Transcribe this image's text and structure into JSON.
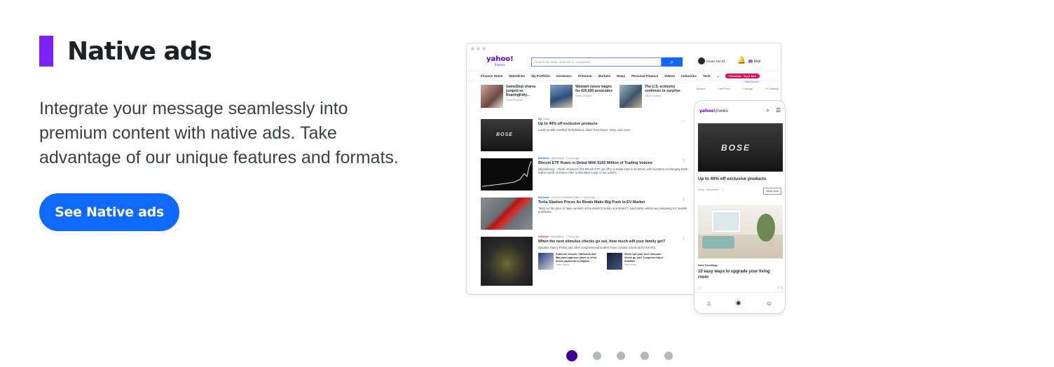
{
  "section": {
    "title": "Native ads",
    "description": "Integrate your message seamlessly into premium content with native ads. Take advantage of our unique features and formats.",
    "cta_label": "See Native ads",
    "accent_color": "#7e1fff",
    "cta_color": "#0f69ff"
  },
  "desktop": {
    "logo": "yahoo!",
    "logo_sub": "finance",
    "search_placeholder": "Search for news, symbols or companies",
    "account_label": "Smart Ads El...",
    "mail_label": "Mail",
    "nav_items": [
      "Finance Home",
      "Watchlists",
      "My Portfolio",
      "Screeners",
      "Premium",
      "Markets",
      "News",
      "Personal Finance",
      "Videos",
      "Industries",
      "Tech",
      "..."
    ],
    "premium_pill": "Premium · Try it free",
    "add_symbol": "+ Add Symbol",
    "quote_headers": [
      "Symbol",
      "Last Price",
      "Change",
      "% Change"
    ],
    "top_stories": [
      {
        "title": "GameStop shares jumped as RoaringKitty...",
        "source": "Yahoo Finance"
      },
      {
        "title": "Walmart raises wages for 425,000 associates",
        "source": "Yahoo Finance"
      },
      {
        "title": "The U.S. economy continues to surprise",
        "source": "Yahoo Finance"
      }
    ],
    "feed": [
      {
        "category": "Ad",
        "meta": "eBay",
        "headline": "Up to 40% off exclusive products",
        "summary": "Level up with Certified Refurbished, direct from Razer, Xbox, and more."
      },
      {
        "category": "Business",
        "meta": "Bloomberg · 2 hours ago",
        "headline": "Bitcoin ETF Roars in Debut With $165 Million of Trading Volume",
        "summary": "(Bloomberg) -- North America's first Bitcoin ETF got off to a stellar start in its debut, with investors exchanging $165 million worth of shares.After a relentless surge in the world's..."
      },
      {
        "category": "Business",
        "meta": "Investor's Business Daily · 2 hours ago",
        "headline": "Tesla Slashes Prices As Rivals Make Big Push In EV Market",
        "summary": "Tesla cut the price of base variants of the Model 3 sedan and Model Y sport utility vehicle as competing EV models proliferate."
      },
      {
        "category": "Lifestyle",
        "meta": "MarketWise · 2 hours ago",
        "headline": "When the next stimulus checks go out, how much will your family get?",
        "summary": "Speaker Nancy Pelosi and other congressional leaders have created a formula for the IRS."
      }
    ],
    "sub_stories": [
      {
        "title": "Stimulus checks: California and Maryland approve plans to send direct payments to eligible...",
        "source": "Yahoo Money"
      },
      {
        "title": "When will your next stimulus check go out? Congress has a deadline",
        "source": "MarketWise"
      }
    ],
    "ad_brand": "BOSE"
  },
  "mobile": {
    "logo": "yahoo!",
    "logo_section": "news",
    "ad_headline": "Up to 40% off exclusive products",
    "sponsor": "eBay · Sponsored · ⓘ",
    "shop_now": "Shop Now",
    "category": "Home Furnishings",
    "article_headline": "10 easy ways to upgrade your living room",
    "ad_brand": "BOSE"
  },
  "carousel": {
    "count": 5,
    "active_index": 0,
    "active_color": "#400090",
    "inactive_color": "#b0b9c1"
  }
}
